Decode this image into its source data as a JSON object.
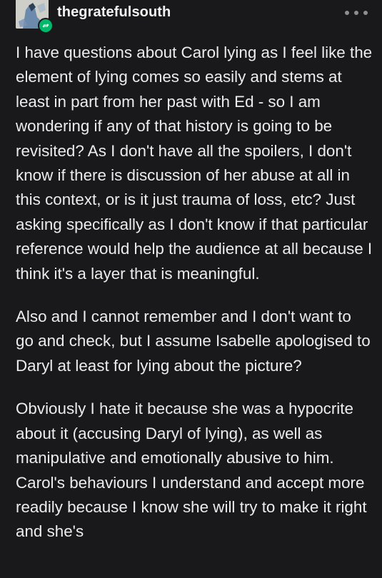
{
  "post": {
    "username": "thegratefulsouth",
    "avatar_icon": "avatar-image",
    "reblog_badge_icon": "reblog-icon",
    "more_icon": "more-options-icon",
    "colors": {
      "background": "#19191b",
      "text": "#ececec",
      "reblog_badge": "#00b86b",
      "more_dots": "#8e8e8e"
    },
    "paragraphs": [
      "I have questions about Carol lying as I feel like the element of lying comes so easily and stems at least in part from her past with Ed - so I am wondering if any of that history is going to be revisited? As I don't have all the spoilers, I don't know if there is discussion of her abuse at all in this context, or is it just trauma of loss, etc? Just asking specifically as I don't know if that particular reference would help the audience at all because I think it's a layer that is meaningful.",
      "Also and I cannot remember and I don't want to go and check, but I assume Isabelle apologised to Daryl at least for lying about the picture?",
      "Obviously I hate it because she was a hypocrite about it (accusing Daryl of lying), as well as manipulative and emotionally abusive to him. Carol's behaviours I understand and accept more readily because I know she will try to make it right and she's"
    ]
  }
}
